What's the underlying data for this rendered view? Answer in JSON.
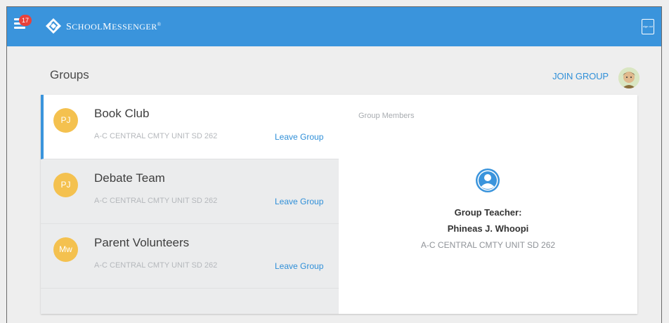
{
  "header": {
    "notification_count": "17",
    "brand_first": "S",
    "brand_rest": "CHOOL",
    "brand_first2": "M",
    "brand_rest2": "ESSENGER",
    "brand_mark": "®",
    "signout_label": "sign out",
    "background_color": "#3a94dc"
  },
  "page": {
    "title": "Groups",
    "join_label": "JOIN GROUP"
  },
  "groups": [
    {
      "initials": "PJ",
      "name": "Book Club",
      "org": "A-C CENTRAL CMTY UNIT SD 262",
      "leave_label": "Leave Group",
      "selected": true
    },
    {
      "initials": "PJ",
      "name": "Debate Team",
      "org": "A-C CENTRAL CMTY UNIT SD 262",
      "leave_label": "Leave Group",
      "selected": false
    },
    {
      "initials": "Mw",
      "name": "Parent Volunteers",
      "org": "A-C CENTRAL CMTY UNIT SD 262",
      "leave_label": "Leave Group",
      "selected": false
    }
  ],
  "members": {
    "label": "Group Members",
    "role": "Group Teacher:",
    "name": "Phineas J. Whoopi",
    "org": "A-C CENTRAL CMTY UNIT SD 262",
    "icon": "user-circle-icon"
  },
  "colors": {
    "accent": "#3a94dc",
    "badge": "#f4c14f",
    "notification": "#e8413b"
  }
}
